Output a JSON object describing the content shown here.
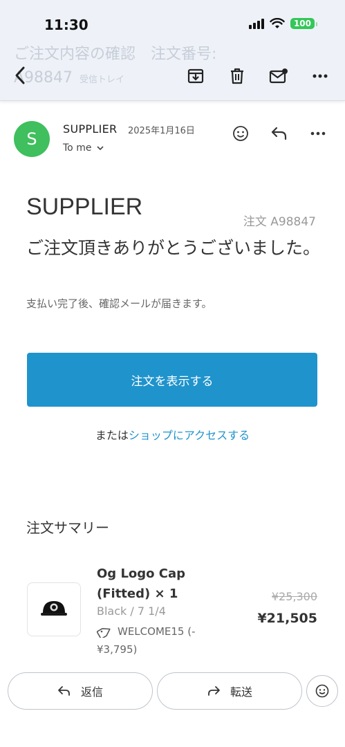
{
  "status_bar": {
    "time": "11:30",
    "battery": "100"
  },
  "header": {
    "subject_line1": "ご注文内容の確認　注文番号:",
    "subject_line2": "A98847",
    "folder_label": "受信トレイ"
  },
  "message": {
    "sender_initial": "S",
    "sender_name": "SUPPLIER",
    "date": "2025年1月16日",
    "recipient": "To me"
  },
  "body": {
    "brand": "SUPPLIER",
    "order_number": "注文 A98847",
    "thanks": "ご注文頂きありがとうございました。",
    "paid_note": "支払い完了後、確認メールが届きます。",
    "view_order_button": "注文を表示する",
    "or_text": "または",
    "shop_link": "ショップにアクセスする",
    "summary_title": "注文サマリー"
  },
  "items": [
    {
      "name": "Og Logo Cap (Fitted) × 1",
      "variant": "Black / 7 1/4",
      "discount": "WELCOME15 (-¥3,795)",
      "original_price": "¥25,300",
      "price": "¥21,505"
    }
  ],
  "actions": {
    "reply": "返信",
    "forward": "転送"
  },
  "icons": [
    "back-icon",
    "archive-icon",
    "trash-icon",
    "mark-unread-icon",
    "more-icon",
    "emoji-icon",
    "reply-icon",
    "tag-icon",
    "forward-icon"
  ],
  "colors": {
    "accent": "#1f93cc",
    "avatar": "#3fbf5d",
    "battery": "#34c759"
  }
}
